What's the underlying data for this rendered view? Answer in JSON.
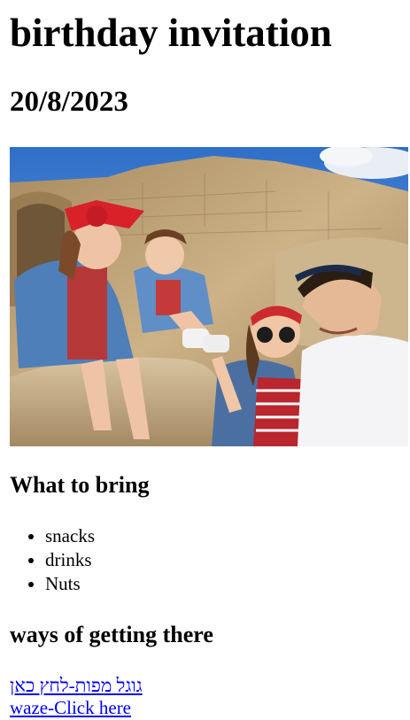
{
  "header": {
    "title": "birthday invitation",
    "date": "20/8/2023"
  },
  "photo": {
    "alt": "family photo at ancient stone ruins"
  },
  "bring": {
    "heading": "What to bring",
    "items": [
      "snacks",
      "drinks",
      "Nuts"
    ]
  },
  "directions": {
    "heading": "ways of getting there",
    "links": [
      {
        "label": "גוגל מפות-לחץ כאן"
      },
      {
        "label": "waze-Click here"
      }
    ]
  },
  "colors": {
    "link": "#0000ee",
    "sky": "#3f86d8",
    "stone": "#c2a57a"
  }
}
